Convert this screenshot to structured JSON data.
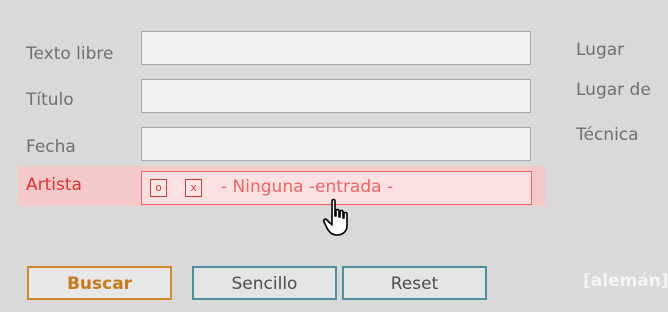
{
  "form": {
    "fields": [
      {
        "label": "Texto libre",
        "value": ""
      },
      {
        "label": "Título",
        "value": ""
      },
      {
        "label": "Fecha",
        "value": ""
      }
    ],
    "artist": {
      "label": "Artista",
      "button_o": "o",
      "button_x": "x",
      "value": "- Ninguna -entrada -"
    },
    "right_labels": [
      "Lugar",
      "Lugar de",
      "Técnica"
    ]
  },
  "buttons": {
    "search": "Buscar",
    "simple": "Sencillo",
    "reset": "Reset"
  },
  "language_link": "[alemán]",
  "colors": {
    "background": "#d9d9d9",
    "artist_highlight": "#f3c9c9",
    "artist_text": "#e03131",
    "search_accent": "#d08a2a",
    "button_border": "#4b8fa0"
  },
  "icons": {
    "cursor": "hand-pointer-icon"
  }
}
